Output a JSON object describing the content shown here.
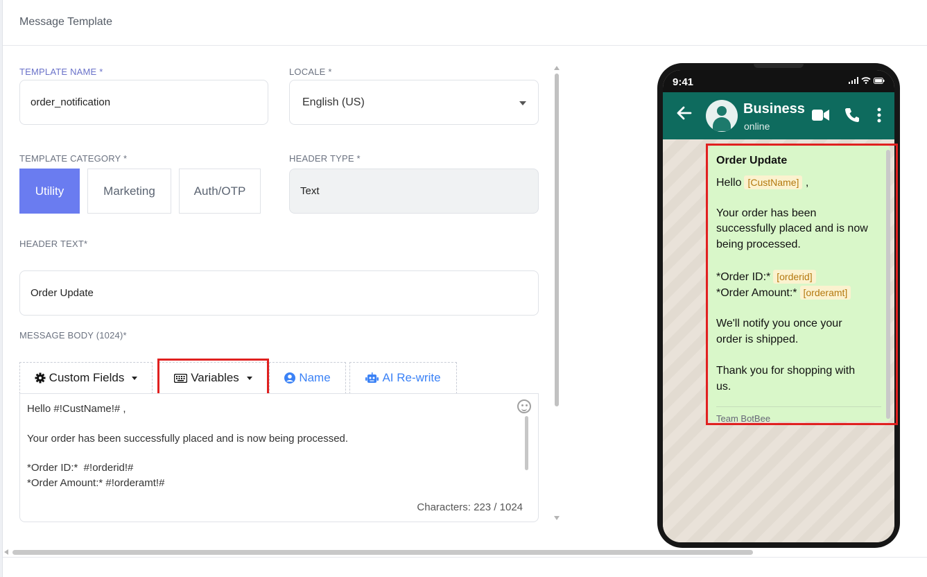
{
  "modal": {
    "title": "Message Template"
  },
  "form": {
    "template_name": {
      "label": "TEMPLATE NAME *",
      "value": "order_notification"
    },
    "locale": {
      "label": "LOCALE *",
      "value": "English (US)"
    },
    "template_category": {
      "label": "TEMPLATE CATEGORY *",
      "options": [
        "Utility",
        "Marketing",
        "Auth/OTP"
      ],
      "selected": "Utility"
    },
    "header_type": {
      "label": "HEADER TYPE *",
      "value": "Text"
    },
    "header_text": {
      "label": "HEADER TEXT*",
      "value": "Order Update"
    },
    "message_body": {
      "label": "MESSAGE BODY (1024)*",
      "toolbar": {
        "custom_fields": "Custom Fields",
        "variables": "Variables",
        "name": "Name",
        "ai_rewrite": "AI Re-write"
      },
      "lines": [
        "Hello #!CustName!# ,",
        "",
        "Your order has been successfully placed and is now being processed.",
        "",
        "*Order ID:*  #!orderid!#",
        "*Order Amount:* #!orderamt!#"
      ],
      "char_count": "Characters: 223 / 1024"
    }
  },
  "preview": {
    "time": "9:41",
    "contact_name": "Business",
    "contact_status": "online",
    "bubble": {
      "title": "Order Update",
      "hello": "Hello",
      "var_custname": "[CustName]",
      "comma": ",",
      "body_line1": "Your order has been",
      "body_line2": "successfully placed and is now",
      "body_line3": "being processed.",
      "order_id_label": "*Order ID:*",
      "var_orderid": "[orderid]",
      "order_amount_label": "*Order Amount:*",
      "var_orderamt": "[orderamt]",
      "notify_line1": "We'll notify you once your",
      "notify_line2": "order is shipped.",
      "thanks_line1": "Thank you for shopping with",
      "thanks_line2": "us.",
      "footer": "Team BotBee"
    }
  },
  "colors": {
    "accent": "#6a7cf0",
    "whatsapp_header": "#0e6b5e",
    "bubble": "#d9f7c9",
    "highlight_box": "#e0201f",
    "link_blue": "#3b82f6"
  },
  "icons": [
    "gear-icon",
    "keyboard-icon",
    "user-circle-icon",
    "robot-icon",
    "emoji-icon",
    "back-arrow-icon",
    "video-icon",
    "phone-icon",
    "more-vert-icon"
  ]
}
